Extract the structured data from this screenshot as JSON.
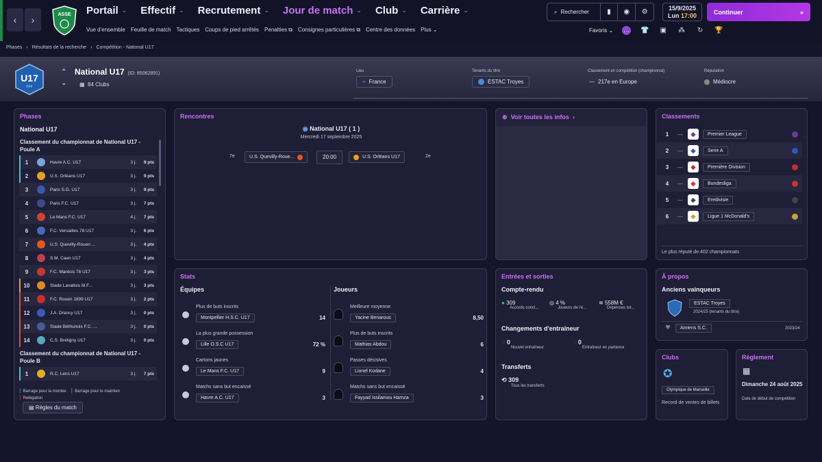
{
  "nav": {
    "back": "‹",
    "forward": "›",
    "items": [
      {
        "label": "Portail",
        "dropdown": true
      },
      {
        "label": "Effectif",
        "dropdown": true
      },
      {
        "label": "Recrutement",
        "dropdown": true
      },
      {
        "label": "Jour de match",
        "dropdown": true,
        "active": true
      },
      {
        "label": "Club",
        "dropdown": true
      },
      {
        "label": "Carrière",
        "dropdown": true
      }
    ],
    "sub": [
      "Vue d'ensemble",
      "Feuille de match",
      "Tactiques",
      "Coups de pied arrêtés",
      "Penalties",
      "Consignes particulières",
      "Centre des données",
      "Plus"
    ],
    "crest_text": "ASSE"
  },
  "tools": {
    "search": "Rechercher"
  },
  "date": {
    "day": "15/9/2025",
    "weekday": "Lun",
    "time": "17:00"
  },
  "continue_label": "Continuer",
  "favs": "Favoris",
  "breadcrumbs": [
    "Phases",
    "Résultats de la recherche",
    "Compétition - National U17"
  ],
  "comp": {
    "badge": "U17",
    "badge_sub": "FFF",
    "name": "National U17",
    "id": "(ID: 85062891)",
    "clubs": "84 Clubs",
    "lieu_label": "Lieu",
    "lieu": "France",
    "tenants_label": "Tenants du titre",
    "tenants": "ESTAC Troyes",
    "classement_label": "Classement en compétition (championnat)",
    "classement": "217e en Europe",
    "reputation_label": "Réputation",
    "reputation": "Médiocre"
  },
  "phases": {
    "title": "Phases",
    "comp": "National U17",
    "groupA": "Classement du championnat de National U17 - Poule A",
    "rows": [
      {
        "pos": "1",
        "name": "Havre A.C. U17",
        "pl": "3 j.",
        "pts": "9 pts",
        "mark": "#3cc6d8",
        "color": "#7aa7d8"
      },
      {
        "pos": "2",
        "name": "U.S. Orléans U17",
        "pl": "3 j.",
        "pts": "9 pts",
        "mark": "#3cc6d8",
        "color": "#e6a020"
      },
      {
        "pos": "3",
        "name": "Paris S.G. U17",
        "pl": "3 j.",
        "pts": "9 pts",
        "mark": "",
        "color": "#3a5aa8"
      },
      {
        "pos": "4",
        "name": "Paris F.C. U17",
        "pl": "3 j.",
        "pts": "7 pts",
        "mark": "",
        "color": "#3a4a88"
      },
      {
        "pos": "5",
        "name": "Le Mans F.C. U17",
        "pl": "4 j.",
        "pts": "7 pts",
        "mark": "",
        "color": "#d24030"
      },
      {
        "pos": "6",
        "name": "F.C. Versailles 78 U17",
        "pl": "3 j.",
        "pts": "6 pts",
        "mark": "",
        "color": "#4a6ab8"
      },
      {
        "pos": "7",
        "name": "U.S. Quevilly-Rouen ...",
        "pl": "3 j.",
        "pts": "4 pts",
        "mark": "",
        "color": "#e05a20"
      },
      {
        "pos": "8",
        "name": "S.M. Caen U17",
        "pl": "3 j.",
        "pts": "4 pts",
        "mark": "",
        "color": "#b84050"
      },
      {
        "pos": "9",
        "name": "F.C. Mantois 78 U17",
        "pl": "3 j.",
        "pts": "3 pts",
        "mark": "",
        "color": "#c83838"
      },
      {
        "pos": "10",
        "name": "Stade Lavallois M.F...",
        "pl": "3 j.",
        "pts": "3 pts",
        "mark": "#e0a030",
        "color": "#e08a20"
      },
      {
        "pos": "11",
        "name": "F.C. Rouen 1899 U17",
        "pl": "3 j.",
        "pts": "2 pts",
        "mark": "#e05030",
        "color": "#c83030"
      },
      {
        "pos": "12",
        "name": "J.A. Drancy U17",
        "pl": "3 j.",
        "pts": "0 pts",
        "mark": "#e05030",
        "color": "#3a5ab8"
      },
      {
        "pos": "13",
        "name": "Stade Béthunois F.C. ...",
        "pl": "3 j.",
        "pts": "0 pts",
        "mark": "#e05030",
        "color": "#4a5a98"
      },
      {
        "pos": "14",
        "name": "C.S. Brétigny U17",
        "pl": "3 j.",
        "pts": "0 pts",
        "mark": "#e05030",
        "color": "#5aa8b8"
      }
    ],
    "groupB": "Classement du championnat de National U17 - Poule B",
    "rowsB": [
      {
        "pos": "1",
        "name": "R.C. Lens U17",
        "pl": "3 j.",
        "pts": "7 pts",
        "mark": "#3cc6d8",
        "color": "#e0b020"
      }
    ],
    "legend": [
      "Barrage pour la montée",
      "Barrage pour le maintien",
      "Relégation"
    ],
    "legend_colors": [
      "#3cc6d8",
      "#e0a030",
      "#e05030"
    ],
    "rules": "Règles du match"
  },
  "rencontres": {
    "title": "Rencontres",
    "comp": "National U17  ( 1 )",
    "date": "Mercredi 17 septembre 2025",
    "home_rank": "7e",
    "home": "U.S. Quevilly-Roue...",
    "time": "20:00",
    "away": "U.S. Orléans U17",
    "away_rank": "2e"
  },
  "info": {
    "title": "Voir toutes les infos"
  },
  "classements": {
    "title": "Classements",
    "rows": [
      {
        "pos": "1",
        "name": "Premier League"
      },
      {
        "pos": "2",
        "name": "Serie A"
      },
      {
        "pos": "3",
        "name": "Première Division"
      },
      {
        "pos": "4",
        "name": "Bundesliga"
      },
      {
        "pos": "5",
        "name": "Eredivisie"
      },
      {
        "pos": "6",
        "name": "Ligue 1 McDonald's"
      }
    ],
    "footer": "Le plus réputé de 402 championnats"
  },
  "stats": {
    "title": "Stats",
    "teams_h": "Équipes",
    "players_h": "Joueurs",
    "teams": [
      {
        "label": "Plus de buts inscrits",
        "name": "Montpellier H.S.C. U17",
        "val": "14"
      },
      {
        "label": "La plus grande possession",
        "name": "Lille O.S.C U17",
        "val": "72 %"
      },
      {
        "label": "Cartons jaunes",
        "name": "Le Mans F.C. U17",
        "val": "9"
      },
      {
        "label": "Matchs sans but encaissé",
        "name": "Havre A.C. U17",
        "val": "3"
      }
    ],
    "players": [
      {
        "label": "Meilleure moyenne",
        "name": "Yacine Benarous",
        "val": "8,50"
      },
      {
        "label": "Plus de buts inscrits",
        "name": "Mathias Abdou",
        "val": "6"
      },
      {
        "label": "Passes décisives",
        "name": "Lionel Kodane",
        "val": "4"
      },
      {
        "label": "Matchs sans but encaissé",
        "name": "Fayyad Issilamou Hamza",
        "val": "3"
      }
    ]
  },
  "transfers": {
    "title": "Entrées et sorties",
    "compte": "Compte-rendu",
    "a1": "309",
    "a1l": "Accords concl...",
    "a2": "4 %",
    "a2l": "Joueurs de l'é...",
    "a3": "558M €",
    "a3l": "Dépenses tot...",
    "coach_h": "Changements d'entraîneur",
    "c1": "0",
    "c1l": "Nouvel entraîneur",
    "c2": "0",
    "c2l": "Entraîneur en partance",
    "tr_h": "Transferts",
    "t1": "309",
    "t1l": "Tous les transferts"
  },
  "apropos": {
    "title": "À propos",
    "winners": "Anciens vainqueurs",
    "w1": "ESTAC Troyes",
    "w1s": "2024/25 (tenants du titre)",
    "w2": "Amiens S.C.",
    "w2s": "2023/24"
  },
  "clubs": {
    "title": "Clubs",
    "club": "Olympique de Marseille",
    "desc": "Record de ventes de billets"
  },
  "reglement": {
    "title": "Règlement",
    "date": "Dimanche 24 août 2025",
    "desc": "Date de début de compétition"
  }
}
